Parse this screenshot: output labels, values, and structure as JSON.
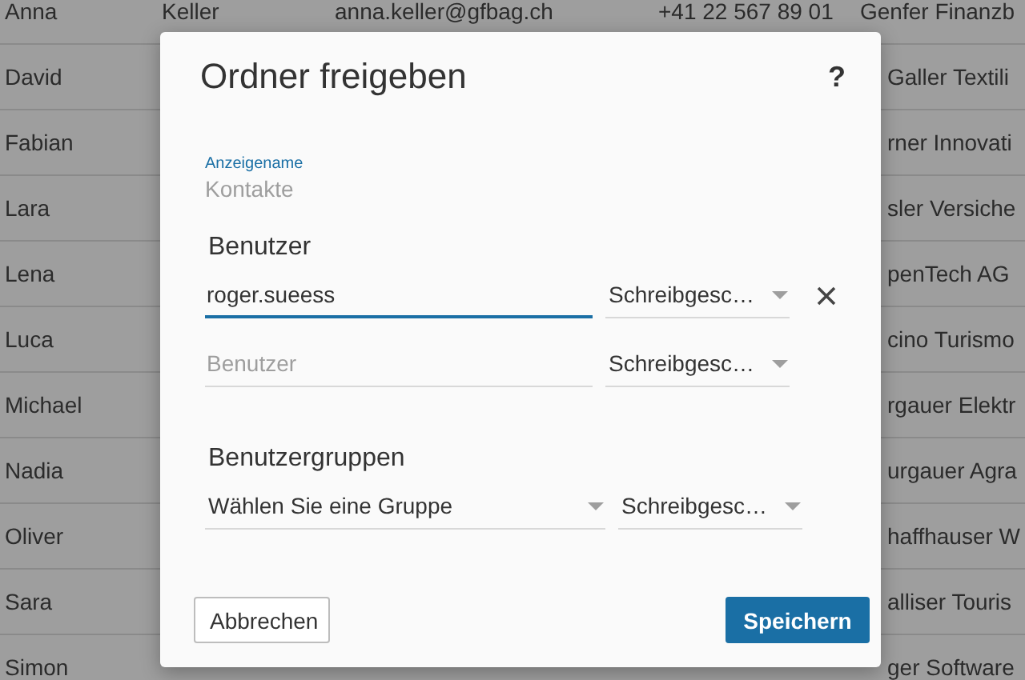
{
  "table": {
    "rows": [
      {
        "first_name": "Anna",
        "last_name": "Keller",
        "email": "anna.keller@gfbag.ch",
        "phone": "+41 22 567 89 01",
        "column_5": "Genfer Finanzb"
      },
      {
        "first_name": "David",
        "column_5": "Galler Textili"
      },
      {
        "first_name": "Fabian",
        "column_5": "rner Innovati"
      },
      {
        "first_name": "Lara",
        "column_5": "sler Versiche"
      },
      {
        "first_name": "Lena",
        "column_5": "penTech AG"
      },
      {
        "first_name": "Luca",
        "column_5": "cino Turismo"
      },
      {
        "first_name": "Michael",
        "column_5": "rgauer Elektr"
      },
      {
        "first_name": "Nadia",
        "column_5": "urgauer Agra"
      },
      {
        "first_name": "Oliver",
        "column_5": "haffhauser W"
      },
      {
        "first_name": "Sara",
        "column_5": "alliser Touris"
      },
      {
        "first_name": "Simon",
        "column_5": "ger Software"
      }
    ]
  },
  "dialog": {
    "title": "Ordner freigeben",
    "help": "?",
    "display_name": {
      "label": "Anzeigename",
      "value": "Kontakte"
    },
    "users": {
      "heading": "Benutzer",
      "rows": [
        {
          "value": "roger.sueess",
          "focused": true,
          "permission": "Schreibgesc…",
          "removable": true
        },
        {
          "placeholder": "Benutzer",
          "focused": false,
          "permission": "Schreibgesc…",
          "removable": false
        }
      ]
    },
    "groups": {
      "heading": "Benutzergruppen",
      "rows": [
        {
          "group": "Wählen Sie eine Gruppe",
          "permission": "Schreibgesc…"
        }
      ]
    },
    "buttons": [
      {
        "label": "Abbrechen",
        "kind": "secondary"
      },
      {
        "label": "Speichern",
        "kind": "primary"
      }
    ]
  }
}
